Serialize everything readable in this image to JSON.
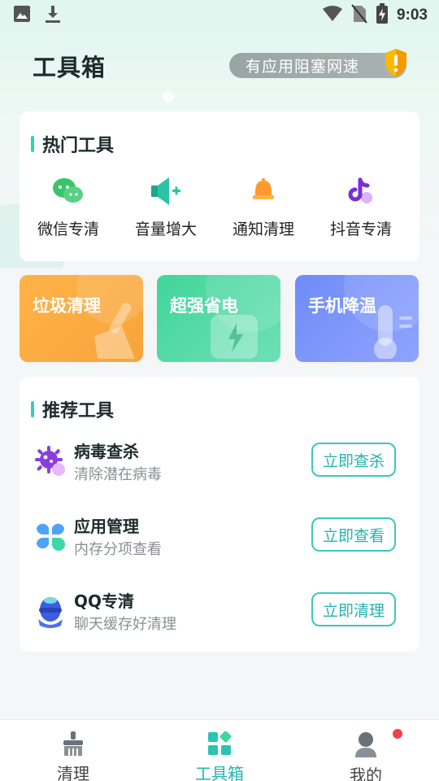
{
  "status_bar": {
    "time": "9:03",
    "left_icons": [
      "image-icon",
      "download-icon"
    ],
    "right_icons": [
      "wifi-icon",
      "no-sim-icon",
      "battery-charging-icon"
    ]
  },
  "header": {
    "title": "工具箱",
    "warning_text": "有应用阻塞网速",
    "warning_icon": "shield-alert-icon"
  },
  "hot_tools": {
    "title": "热门工具",
    "items": [
      {
        "label": "微信专清",
        "icon": "wechat-icon",
        "color": "#39c46c"
      },
      {
        "label": "音量增大",
        "icon": "volume-up-icon",
        "color": "#2bc3a5"
      },
      {
        "label": "通知清理",
        "icon": "bell-icon",
        "color": "#ff9a2e"
      },
      {
        "label": "抖音专清",
        "icon": "tiktok-icon",
        "color": "#8a3ce0"
      }
    ]
  },
  "feature_tiles": [
    {
      "title": "垃圾清理",
      "icon": "broom-icon"
    },
    {
      "title": "超强省电",
      "icon": "battery-bolt-icon"
    },
    {
      "title": "手机降温",
      "icon": "thermometer-icon"
    }
  ],
  "recommended": {
    "title": "推荐工具",
    "items": [
      {
        "name": "病毒查杀",
        "desc": "清除潜在病毒",
        "button": "立即查杀",
        "icon": "virus-icon"
      },
      {
        "name": "应用管理",
        "desc": "内存分项查看",
        "button": "立即查看",
        "icon": "apps-icon"
      },
      {
        "name": "QQ专清",
        "desc": "聊天缓存好清理",
        "button": "立即清理",
        "icon": "qq-icon"
      }
    ]
  },
  "bottom_nav": {
    "items": [
      {
        "label": "清理",
        "icon": "broom-icon"
      },
      {
        "label": "工具箱",
        "icon": "toolbox-icon",
        "active": true
      },
      {
        "label": "我的",
        "icon": "user-icon",
        "badge": true
      }
    ]
  },
  "colors": {
    "accent": "#23b4ad",
    "section_bar": "#2ed3b8",
    "badge_red": "#f2404a"
  }
}
